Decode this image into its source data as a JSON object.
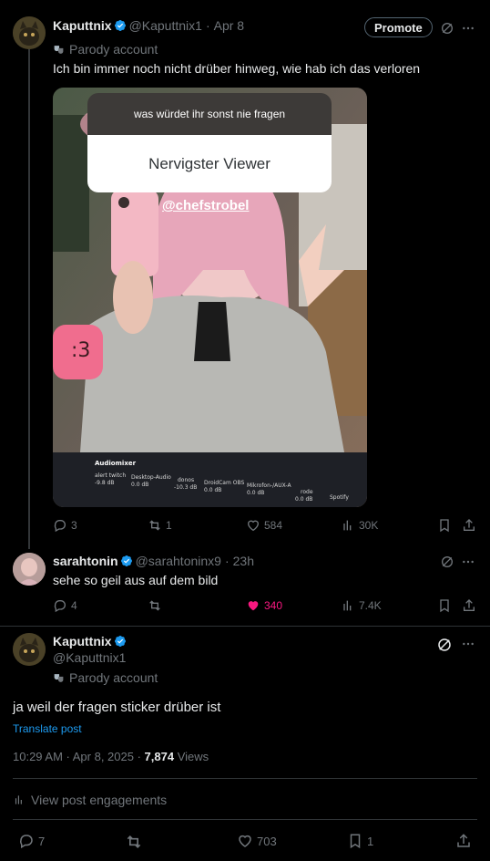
{
  "post1": {
    "name": "Kaputtnix",
    "handle": "@Kaputtnix1",
    "sep": "·",
    "time": "Apr 8",
    "promote_label": "Promote",
    "parody_label": "Parody account",
    "text": "Ich bin immer noch nicht drüber hinweg, wie hab ich das verloren",
    "media": {
      "sticker_question": "was würdet ihr sonst nie fragen",
      "sticker_answer": "Nervigster Viewer",
      "mention": "@chefstrobel",
      "mixer_title": "Audiomixer",
      "mixer_channels": [
        "alert twitch",
        "Desktop-Audio",
        "donos",
        "DroidCam OBS",
        "Mikrofon-/AUX-A",
        "rode",
        "Spotify"
      ],
      "mixer_levels": [
        "-9.8 dB",
        "0.0 dB",
        "-10.3 dB",
        "0.0 dB",
        "0.0 dB",
        "0.0 dB"
      ]
    },
    "actions": {
      "replies": "3",
      "reposts": "1",
      "likes": "584",
      "views": "30K"
    }
  },
  "post2": {
    "name": "sarahtonin",
    "handle": "@sarahtoninx9",
    "sep": "·",
    "time": "23h",
    "text": "sehe so geil aus auf dem bild",
    "actions": {
      "replies": "4",
      "reposts": "",
      "likes": "340",
      "views": "7.4K"
    }
  },
  "post3": {
    "name": "Kaputtnix",
    "handle": "@Kaputtnix1",
    "parody_label": "Parody account",
    "text": "ja weil der fragen sticker drüber ist",
    "translate": "Translate post",
    "time": "10:29 AM · Apr 8, 2025 · ",
    "views_count": "7,874",
    "views_label": " Views",
    "engagements": "View post engagements",
    "actions": {
      "replies": "7",
      "reposts": "",
      "likes": "703",
      "bookmarks": "1"
    }
  },
  "colors": {
    "like_active": "#f91880",
    "verified": "#1d9bf0",
    "link": "#1d9bf0"
  }
}
